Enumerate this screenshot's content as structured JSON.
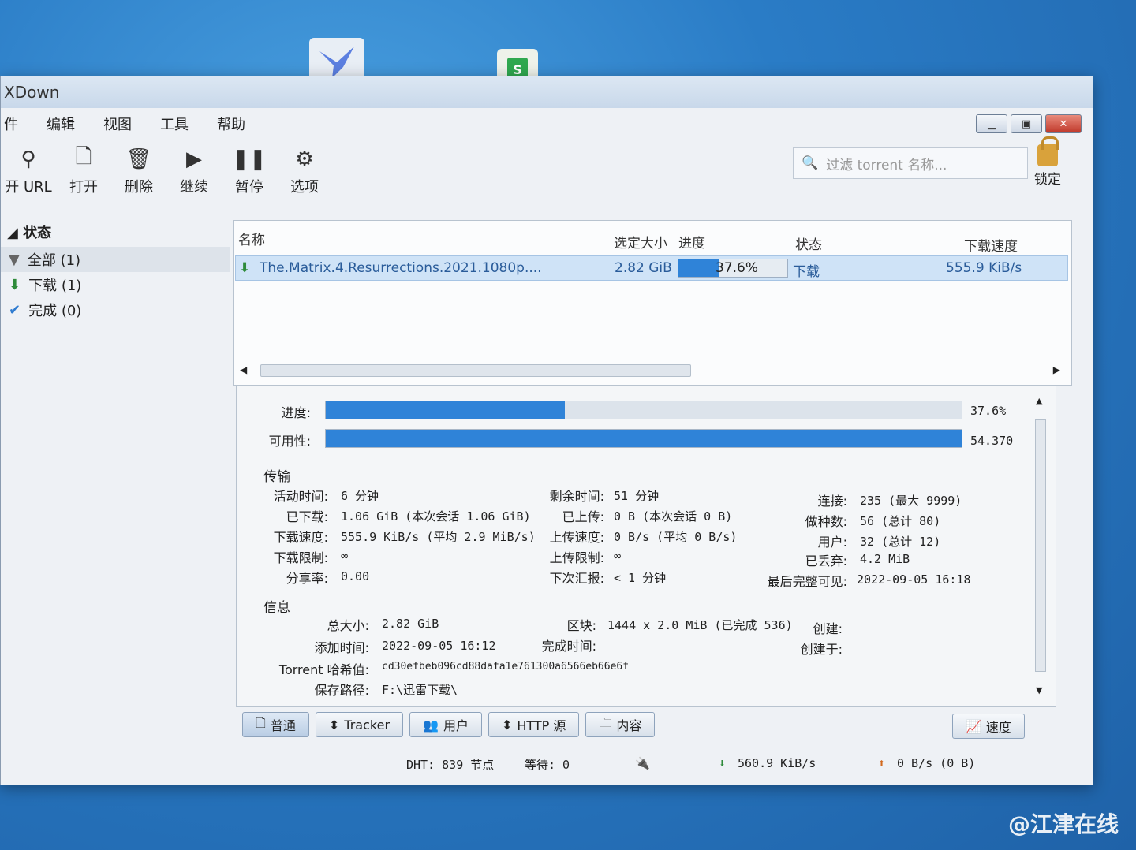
{
  "desktop": {
    "icon2_letter": "S"
  },
  "window": {
    "title": "XDown"
  },
  "menu": [
    "件",
    "编辑",
    "视图",
    "工具",
    "帮助"
  ],
  "toolbar": [
    {
      "icon": "link-icon",
      "label": "开 URL"
    },
    {
      "icon": "open-file-icon",
      "label": "打开"
    },
    {
      "icon": "trash-icon",
      "label": "删除"
    },
    {
      "icon": "play-icon",
      "label": "继续"
    },
    {
      "icon": "pause-icon",
      "label": "暂停"
    },
    {
      "icon": "gear-icon",
      "label": "选项"
    }
  ],
  "filter": {
    "placeholder": "过滤 torrent 名称..."
  },
  "lock_label": "锁定",
  "sidebar": {
    "header": "状态",
    "items": [
      {
        "icon": "filter-icon",
        "label": "全部 (1)"
      },
      {
        "icon": "download-arrow-icon",
        "label": "下载 (1)"
      },
      {
        "icon": "check-icon",
        "label": "完成 (0)"
      }
    ]
  },
  "list": {
    "columns": {
      "name": "名称",
      "size": "选定大小",
      "progress": "进度",
      "status": "状态",
      "speed": "下载速度"
    },
    "rows": [
      {
        "name": "The.Matrix.4.Resurrections.2021.1080p....",
        "size": "2.82 GiB",
        "progress": 0.376,
        "progress_text": "37.6%",
        "status": "下载",
        "speed": "555.9 KiB/s"
      }
    ]
  },
  "detail": {
    "progress_label": "进度:",
    "progress_pct": "37.6%",
    "progress_value": 0.376,
    "availability_label": "可用性:",
    "availability_value": "54.370",
    "transfer_title": "传输",
    "info_title": "信息",
    "transfer": {
      "active_time_l": "活动时间:",
      "active_time": "6 分钟",
      "downloaded_l": "已下载:",
      "downloaded": "1.06 GiB (本次会话 1.06 GiB)",
      "dl_speed_l": "下载速度:",
      "dl_speed": "555.9 KiB/s (平均 2.9 MiB/s)",
      "dl_limit_l": "下载限制:",
      "dl_limit": "∞",
      "ratio_l": "分享率:",
      "ratio": "0.00",
      "eta_l": "剩余时间:",
      "eta": "51 分钟",
      "uploaded_l": "已上传:",
      "uploaded": "0 B (本次会话 0 B)",
      "ul_speed_l": "上传速度:",
      "ul_speed": "0 B/s (平均 0 B/s)",
      "ul_limit_l": "上传限制:",
      "ul_limit": "∞",
      "reannounce_l": "下次汇报:",
      "reannounce": "< 1 分钟",
      "conn_l": "连接:",
      "conn": "235 (最大 9999)",
      "seeds_l": "做种数:",
      "seeds": "56 (总计 80)",
      "peers_l": "用户:",
      "peers": "32 (总计 12)",
      "wasted_l": "已丢弃:",
      "wasted": "4.2 MiB",
      "last_seen_l": "最后完整可见:",
      "last_seen": "2022-09-05 16:18"
    },
    "info": {
      "total_size_l": "总大小:",
      "total_size": "2.82 GiB",
      "added_l": "添加时间:",
      "added": "2022-09-05 16:12",
      "hash_l": "Torrent 哈希值:",
      "hash": "cd30efbeb096cd88dafa1e761300a6566eb66e6f",
      "path_l": "保存路径:",
      "path": "F:\\迅雷下载\\",
      "pieces_l": "区块:",
      "pieces": "1444 x 2.0 MiB (已完成 536)",
      "completed_l": "完成时间:",
      "completed": "",
      "created_by_l": "创建:",
      "created_on_l": "创建于:"
    }
  },
  "tabs": [
    {
      "icon": "doc-icon",
      "label": "普通"
    },
    {
      "icon": "tracker-icon",
      "label": "Tracker"
    },
    {
      "icon": "users-icon",
      "label": "用户"
    },
    {
      "icon": "http-icon",
      "label": "HTTP 源"
    },
    {
      "icon": "folder-icon",
      "label": "内容"
    }
  ],
  "speed_tab": "速度",
  "status": {
    "dht": "DHT: 839 节点",
    "waiting": "等待: 0",
    "down": "560.9 KiB/s",
    "up": "0 B/s (0 B)"
  },
  "watermark": "@江津在线"
}
